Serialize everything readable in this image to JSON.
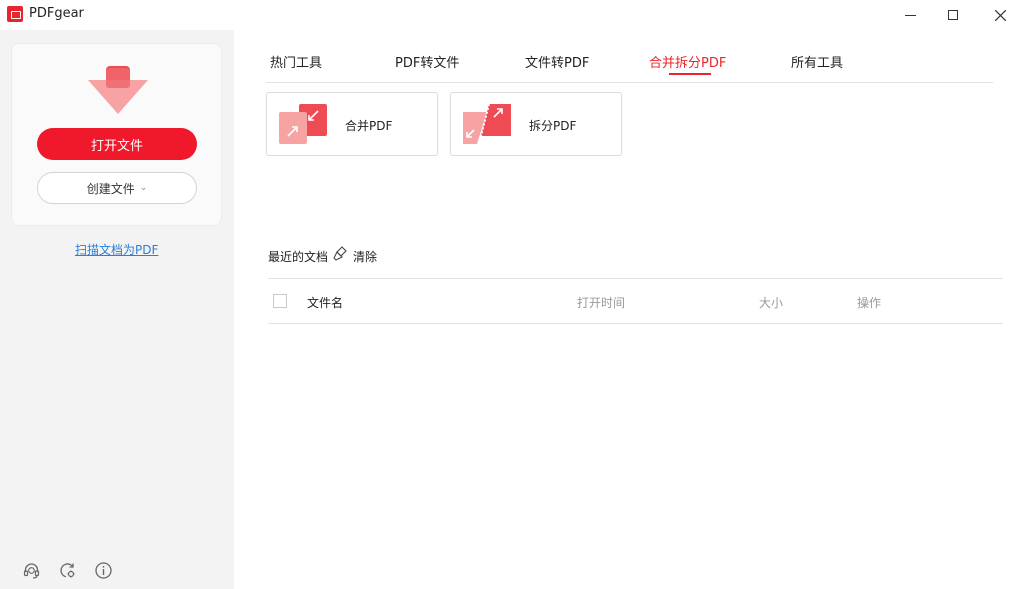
{
  "window": {
    "title": "PDFgear"
  },
  "sidebar": {
    "open_button": "打开文件",
    "create_button": "创建文件",
    "scan_link": "扫描文档为PDF"
  },
  "tabs": [
    {
      "label": "热门工具"
    },
    {
      "label": "PDF转文件"
    },
    {
      "label": "文件转PDF"
    },
    {
      "label": "合并拆分PDF"
    },
    {
      "label": "所有工具"
    }
  ],
  "active_tab": "合并拆分PDF",
  "tools": [
    {
      "label": "合并PDF",
      "icon": "merge-pdf-icon"
    },
    {
      "label": "拆分PDF",
      "icon": "split-pdf-icon"
    }
  ],
  "recent": {
    "title": "最近的文档",
    "clear": "清除",
    "columns": {
      "name": "文件名",
      "time": "打开时间",
      "size": "大小",
      "action": "操作"
    }
  },
  "colors": {
    "accent": "#e8262d",
    "primary_button": "#f0182b",
    "link": "#2b7fd9",
    "sidebar_bg": "#f3f3f3"
  }
}
